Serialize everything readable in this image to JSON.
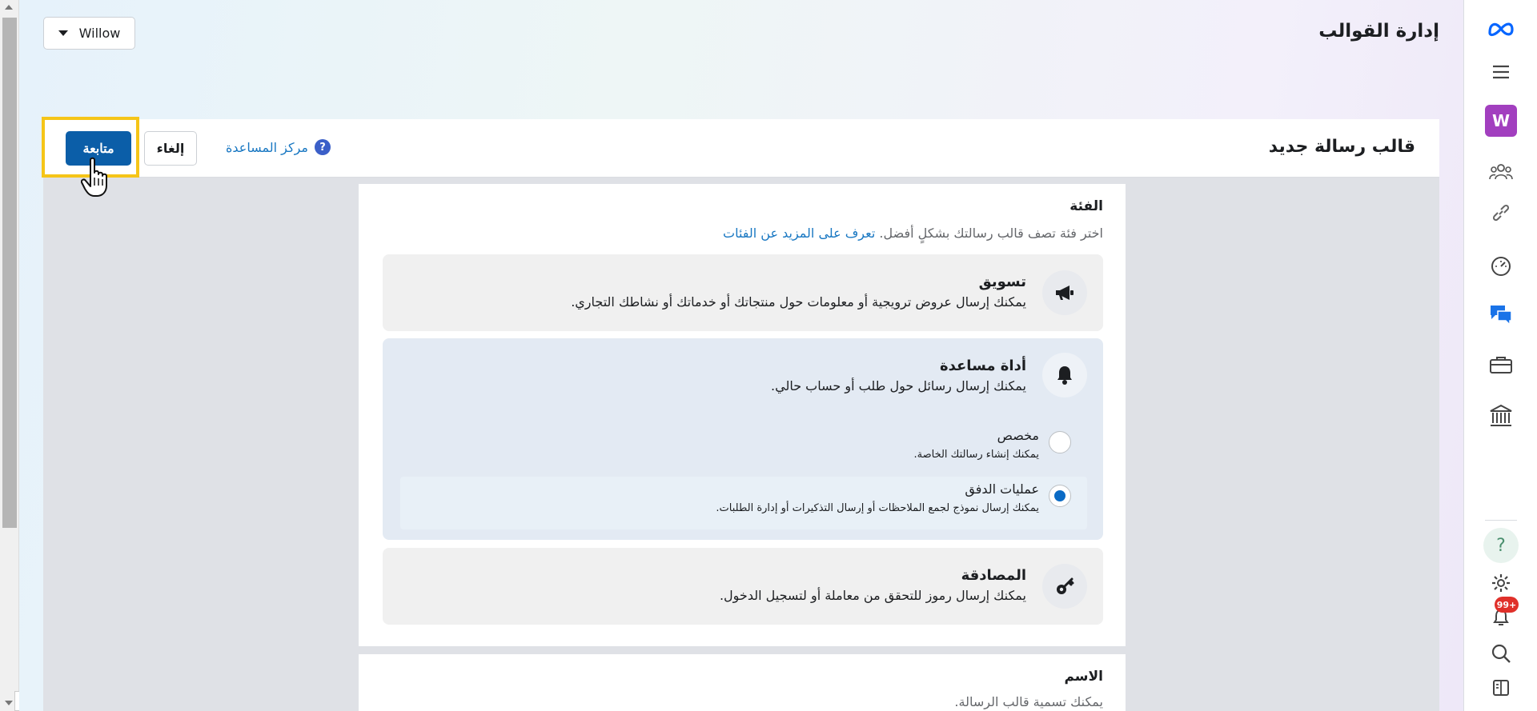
{
  "page": {
    "title": "إدارة القوالب",
    "account_name": "Willow"
  },
  "form_header": {
    "title": "قالب رسالة جديد",
    "continue_label": "متابعة",
    "cancel_label": "إلغاء",
    "help_label": "مركز المساعدة",
    "help_icon_glyph": "?"
  },
  "category": {
    "title": "الفئة",
    "desc": "اختر فئة تصف قالب رسالتك بشكلٍ أفضل.",
    "learn_more": "تعرف على المزيد عن الفئات",
    "options": [
      {
        "title": "تسويق",
        "desc": "يمكنك إرسال عروض ترويجية أو معلومات حول منتجاتك أو خدماتك أو نشاطك التجاري.",
        "icon": "megaphone-icon",
        "selected": false
      },
      {
        "title": "أداة مساعدة",
        "desc": "يمكنك إرسال رسائل حول طلب أو حساب حالي.",
        "icon": "bell-icon",
        "selected": true,
        "sub_options": [
          {
            "title": "مخصص",
            "desc": "يمكنك إنشاء رسالتك الخاصة.",
            "checked": false
          },
          {
            "title": "عمليات الدفق",
            "desc": "يمكنك إرسال نموذج لجمع الملاحظات أو إرسال التذكيرات أو إدارة الطلبات.",
            "checked": true
          }
        ]
      },
      {
        "title": "المصادقة",
        "desc": "يمكنك إرسال رموز للتحقق من معاملة أو لتسجيل الدخول.",
        "icon": "key-icon",
        "selected": false
      }
    ]
  },
  "name_section": {
    "title": "الاسم",
    "desc": "يمكنك تسمية قالب الرسالة."
  },
  "nav": {
    "avatar_letter": "W",
    "help_glyph": "?",
    "notification_count": "99+"
  },
  "colors": {
    "primary": "#0b5ea8",
    "highlight": "#f5c518",
    "link": "#1877c2",
    "avatar": "#a23fbf",
    "badge": "#e0302a"
  }
}
